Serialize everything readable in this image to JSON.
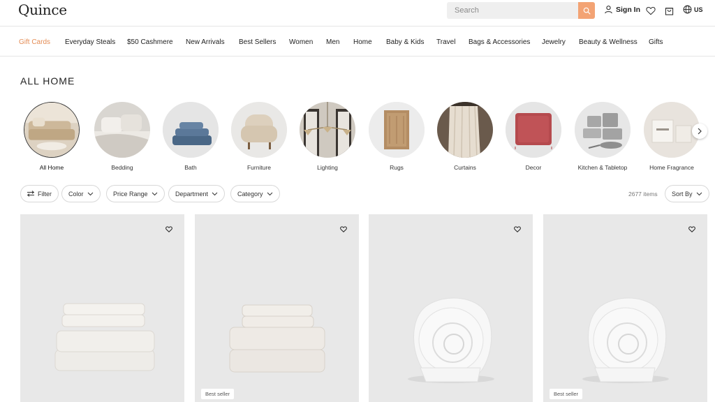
{
  "header": {
    "logo": "Quince",
    "search_placeholder": "Search",
    "signin_label": "Sign In",
    "locale_label": "US",
    "icons": [
      "search-icon",
      "user-icon",
      "heart-icon",
      "cart-icon",
      "globe-icon"
    ]
  },
  "nav": {
    "items": [
      {
        "label": "Gift Cards"
      },
      {
        "label": "Everyday Steals"
      },
      {
        "label": "$50 Cashmere"
      },
      {
        "label": "New Arrivals"
      },
      {
        "label": "Best Sellers"
      },
      {
        "label": "Women"
      },
      {
        "label": "Men"
      },
      {
        "label": "Home"
      },
      {
        "label": "Baby & Kids"
      },
      {
        "label": "Travel"
      },
      {
        "label": "Bags & Accessories"
      },
      {
        "label": "Jewelry"
      },
      {
        "label": "Beauty & Wellness"
      },
      {
        "label": "Gifts"
      }
    ],
    "accent_color": "#e48d56"
  },
  "page": {
    "title": "ALL HOME"
  },
  "categories": [
    {
      "label": "All Home",
      "selected": true
    },
    {
      "label": "Bedding"
    },
    {
      "label": "Bath"
    },
    {
      "label": "Furniture"
    },
    {
      "label": "Lighting"
    },
    {
      "label": "Rugs"
    },
    {
      "label": "Curtains"
    },
    {
      "label": "Decor"
    },
    {
      "label": "Kitchen & Tabletop"
    },
    {
      "label": "Home Fragrance"
    }
  ],
  "filters": {
    "filter_label": "Filter",
    "chips": [
      "Color",
      "Price Range",
      "Department",
      "Category"
    ],
    "item_count": "2677 items",
    "sort_label": "Sort By"
  },
  "products": [
    {
      "badge": ""
    },
    {
      "badge": "Best seller"
    },
    {
      "badge": ""
    },
    {
      "badge": "Best seller"
    }
  ],
  "colors": {
    "search_button": "#f3a374",
    "card_bg": "#e8e8e8"
  }
}
